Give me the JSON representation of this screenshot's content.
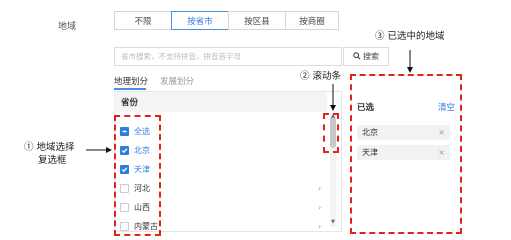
{
  "filter": {
    "label": "地域",
    "segments": [
      {
        "label": "不限",
        "active": false
      },
      {
        "label": "按省市",
        "active": true
      },
      {
        "label": "按区县",
        "active": false
      },
      {
        "label": "按商圈",
        "active": false
      }
    ]
  },
  "search": {
    "placeholder": "省市搜索，不支持拼音、拼音首字母",
    "button_label": "搜索",
    "button_icon": "search-icon"
  },
  "tabs": {
    "active": "地理划分",
    "inactive": "发展划分"
  },
  "list": {
    "header": "省份",
    "items": [
      {
        "label": "全选",
        "state": "partial"
      },
      {
        "label": "北京",
        "state": "checked"
      },
      {
        "label": "天津",
        "state": "checked"
      },
      {
        "label": "河北",
        "state": "unchecked",
        "expandable": true
      },
      {
        "label": "山西",
        "state": "unchecked",
        "expandable": true
      },
      {
        "label": "内蒙古",
        "state": "unchecked",
        "expandable": true
      }
    ]
  },
  "selected": {
    "title": "已选",
    "clear_label": "清空",
    "chips": [
      "北京",
      "天津"
    ],
    "remove_glyph": "×"
  },
  "annotations": {
    "checkbox_note_line1": "① 地域选择",
    "checkbox_note_line2": "复选框",
    "scroll_note": "② 滚动条",
    "selected_note": "③ 已选中的地域"
  },
  "colors": {
    "accent": "#2f7de1",
    "annotation_red": "#e0241b"
  }
}
